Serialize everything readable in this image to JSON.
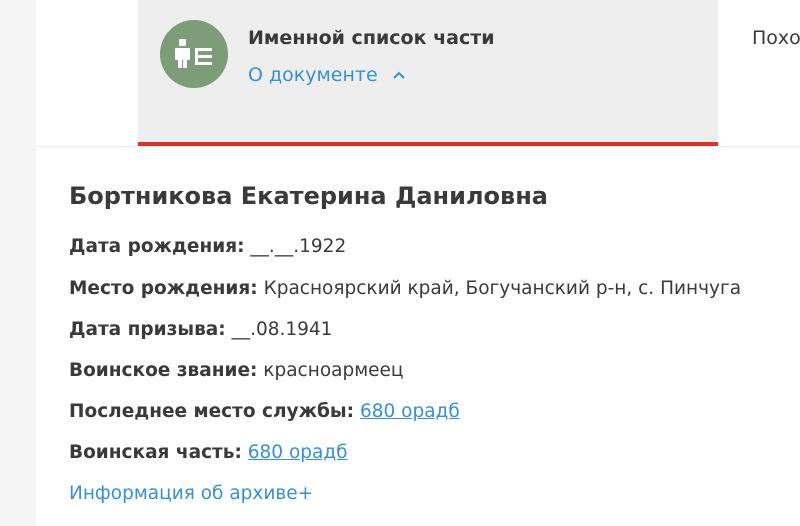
{
  "header": {
    "title": "Именной список части",
    "about_link": "О документе",
    "next_tab": "Похо"
  },
  "person": {
    "name": "Бортникова Екатерина Даниловна"
  },
  "fields": {
    "birth_date": {
      "label": "Дата рождения:",
      "value": "__.__.1922"
    },
    "birth_place": {
      "label": "Место рождения:",
      "value": "Красноярский край, Богучанский р-н, с. Пинчуга"
    },
    "conscription_date": {
      "label": "Дата призыва:",
      "value": "__.08.1941"
    },
    "rank": {
      "label": "Воинское звание:",
      "value": "красноармеец"
    },
    "last_service": {
      "label": "Последнее место службы:",
      "value": "680 орадб"
    },
    "unit": {
      "label": "Воинская часть:",
      "value": "680 орадб"
    }
  },
  "archive_link": "Информация об архиве+",
  "colors": {
    "accent_red": "#d8342c",
    "link_blue": "#3b8fd0",
    "icon_green": "#7d9c78"
  },
  "icons": {
    "document": "document-list-icon",
    "chevron": "chevron-up-icon"
  }
}
